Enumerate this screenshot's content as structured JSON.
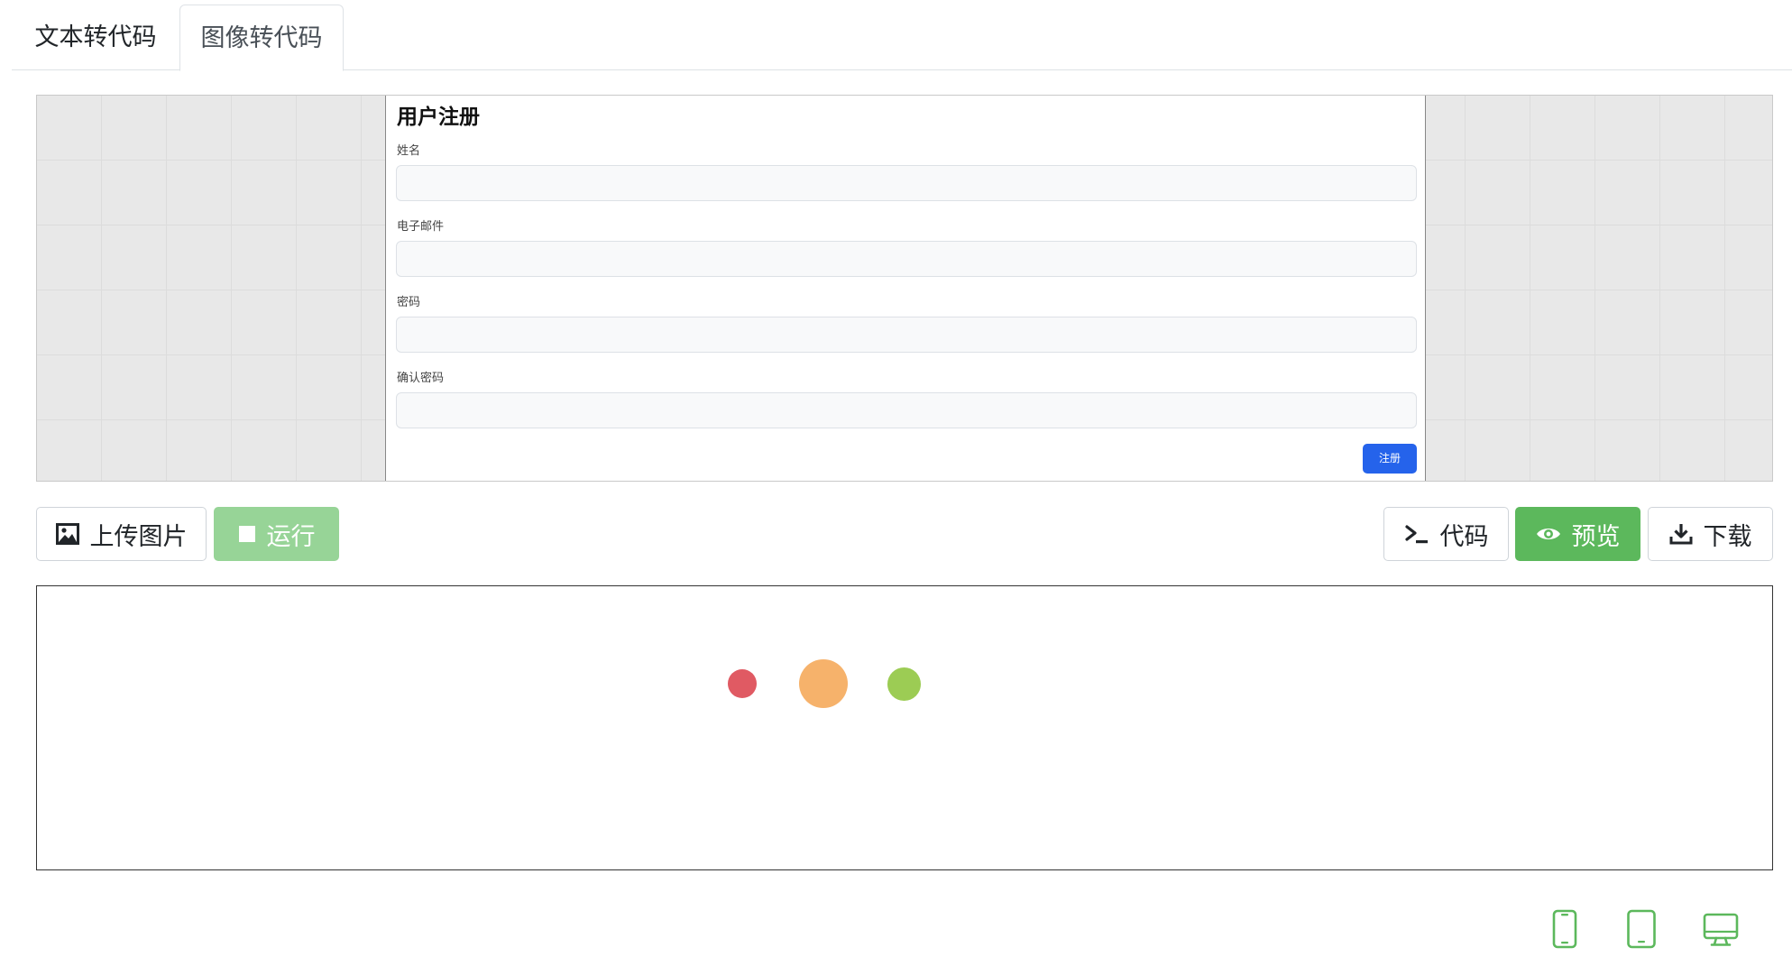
{
  "tabs": [
    {
      "label": "文本转代码",
      "active": false
    },
    {
      "label": "图像转代码",
      "active": true
    }
  ],
  "uploaded_image": {
    "form_title": "用户注册",
    "fields": [
      {
        "label": "姓名"
      },
      {
        "label": "电子邮件"
      },
      {
        "label": "密码"
      },
      {
        "label": "确认密码"
      }
    ],
    "submit_label": "注册"
  },
  "toolbar": {
    "upload_label": "上传图片",
    "run_label": "运行",
    "code_label": "代码",
    "preview_label": "预览",
    "download_label": "下载"
  },
  "loading_dots": [
    {
      "color": "#e05a63"
    },
    {
      "color": "#f6b26b"
    },
    {
      "color": "#9ccc54"
    }
  ],
  "device_icons": [
    "mobile-icon",
    "tablet-icon",
    "desktop-icon"
  ],
  "colors": {
    "success": "#5cb85c",
    "success_disabled": "#97d497",
    "mock_primary": "#2563eb"
  }
}
